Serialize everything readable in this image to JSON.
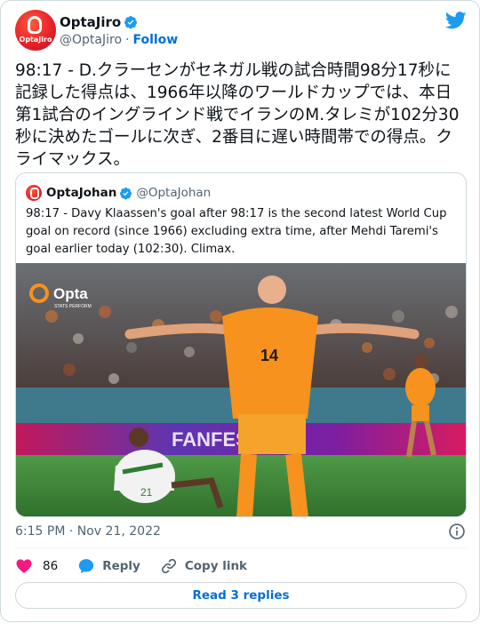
{
  "author": {
    "display_name": "OptaJiro",
    "handle": "@OptaJiro",
    "separator": "·",
    "follow_label": "Follow",
    "avatar_brand": "OptaJiro"
  },
  "tweet": {
    "text": "98:17 - D.クラーセンがセネガル戦の試合時間98分17秒に\n記録した得点は、1966年以降のワールドカップでは、本日\n第1試合のイングラインド戦でイランのM.タレミが102分30\n秒に決めたゴールに次ぎ、2番目に遅い時間帯での得点。ク\nライマックス。"
  },
  "quoted": {
    "display_name": "OptaJohan",
    "handle": "@OptaJohan",
    "text": "98:17 - Davy Klaassen's goal after 98:17 is the second latest World Cup goal on record (since 1966) excluding extra time, after Mehdi Taremi's goal earlier today (102:30). Climax.",
    "photo_watermark": "Opta",
    "photo_watermark_sub": "STATS PERFORM",
    "photo_shirt_number": "14",
    "photo_ad_board": "FANFEST"
  },
  "meta": {
    "timestamp": "6:15 PM · Nov 21, 2022"
  },
  "actions": {
    "like_count": "86",
    "reply_label": "Reply",
    "copy_link_label": "Copy link"
  },
  "footer": {
    "read_replies_label": "Read 3 replies"
  },
  "colors": {
    "accent": "#1d9bf0",
    "like": "#f91880",
    "orange_kit": "#f7921e",
    "pitch": "#3f8a3a"
  },
  "icons": [
    "verified-badge-icon",
    "twitter-bird-icon",
    "info-icon",
    "heart-icon",
    "reply-bubble-icon",
    "link-icon"
  ]
}
